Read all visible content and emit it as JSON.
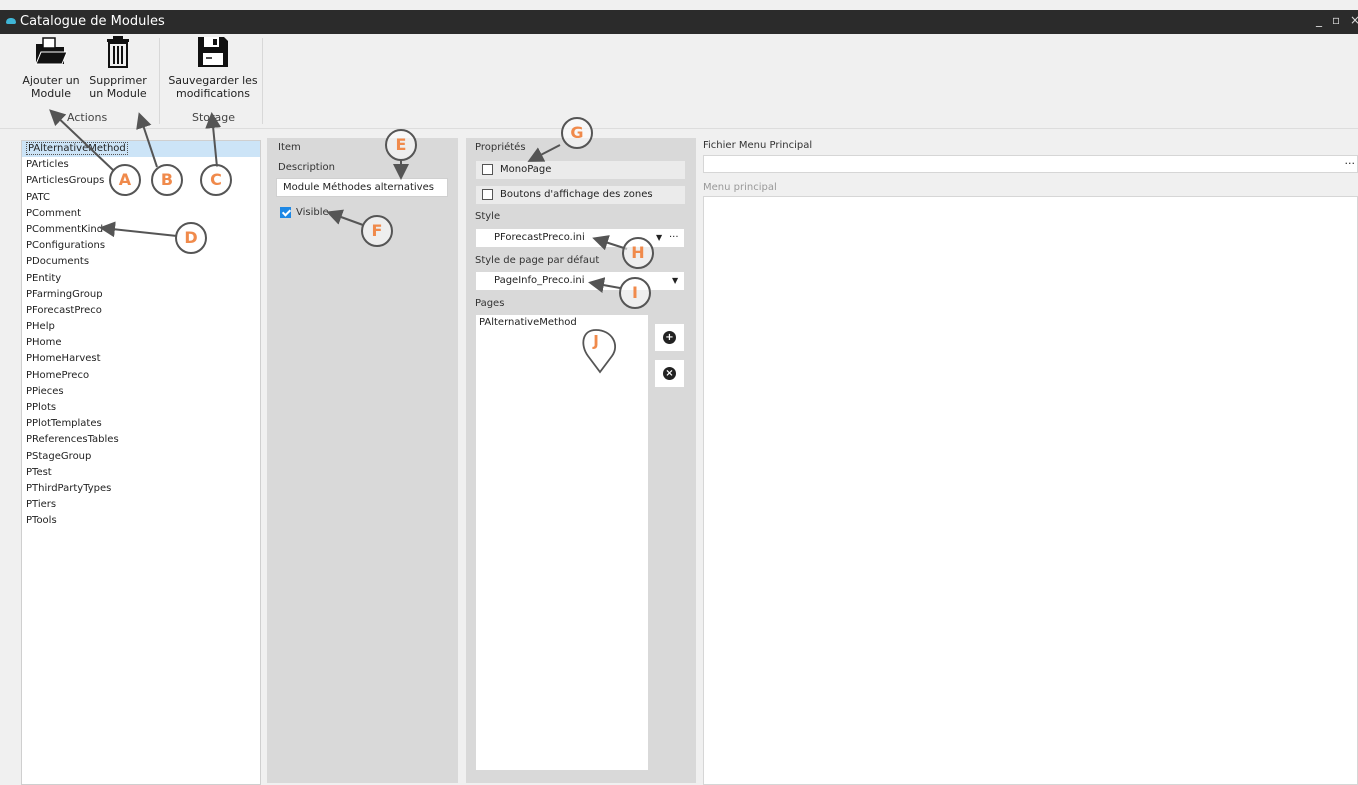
{
  "window": {
    "title": "Catalogue de Modules",
    "minimize": "_",
    "maximize": "▫",
    "close": "×"
  },
  "ribbon": {
    "add_line1": "Ajouter un",
    "add_line2": "Module",
    "delete_line1": "Supprimer",
    "delete_line2": "un Module",
    "save_line1": "Sauvegarder les",
    "save_line2": "modifications",
    "group_actions": "Actions",
    "group_storage": "Storage"
  },
  "modules": [
    "PAlternativeMethod",
    "PArticles",
    "PArticlesGroups",
    "PATC",
    "PComment",
    "PCommentKind",
    "PConfigurations",
    "PDocuments",
    "PEntity",
    "PFarmingGroup",
    "PForecastPreco",
    "PHelp",
    "PHome",
    "PHomeHarvest",
    "PHomePreco",
    "PPieces",
    "PPlots",
    "PPlotTemplates",
    "PReferencesTables",
    "PStageGroup",
    "PTest",
    "PThirdPartyTypes",
    "PTiers",
    "PTools"
  ],
  "item": {
    "header": "Item",
    "description_label": "Description",
    "description_value": "Module Méthodes alternatives",
    "visible_label": "Visible",
    "visible_checked": true
  },
  "props": {
    "header": "Propriétés",
    "monopage_label": "MonoPage",
    "monopage_checked": false,
    "boutons_label": "Boutons d'affichage des zones",
    "boutons_checked": false,
    "style_label": "Style",
    "style_value": "PForecastPreco.ini",
    "default_style_label": "Style de page par défaut",
    "default_style_value": "PageInfo_Preco.ini",
    "pages_label": "Pages",
    "pages": [
      "PAlternativeMethod"
    ]
  },
  "main_menu": {
    "file_label": "Fichier Menu Principal",
    "file_value": "",
    "menu_label": "Menu principal",
    "browse": "···"
  },
  "callouts": [
    "A",
    "B",
    "C",
    "D",
    "E",
    "F",
    "G",
    "H",
    "I",
    "J"
  ],
  "colors": {
    "titlebar": "#2b2b2b",
    "selection": "#cce4f7",
    "accent": "#1e88e5",
    "callout_text": "#f08a4b"
  }
}
